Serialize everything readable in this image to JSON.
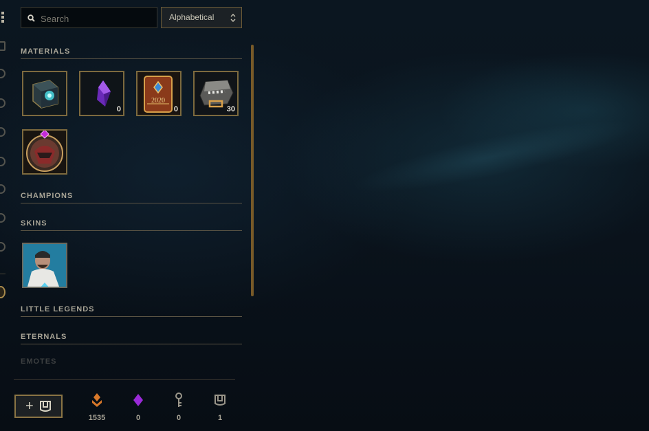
{
  "search": {
    "placeholder": "Search",
    "value": ""
  },
  "sort": {
    "selected": "Alphabetical"
  },
  "sections": {
    "materials": "MATERIALS",
    "champions": "CHAMPIONS",
    "skins": "SKINS",
    "little_legends": "LITTLE LEGENDS",
    "eternals": "ETERNALS",
    "emotes": "EMOTES"
  },
  "materials": [
    {
      "name": "hextech-chest-icon",
      "count": ""
    },
    {
      "name": "gemstone-icon",
      "count": "0"
    },
    {
      "name": "event-pass-token-icon",
      "count": "0",
      "label": "2020"
    },
    {
      "name": "key-fragment-chest-icon",
      "count": "30"
    },
    {
      "name": "champion-orb-icon",
      "count": ""
    }
  ],
  "skins": [
    {
      "name": "skin-shard-icon"
    }
  ],
  "footer": {
    "craft_label": "+",
    "currencies": [
      {
        "name": "orange-essence-icon",
        "value": "1535",
        "color": "#d8782a"
      },
      {
        "name": "mythic-essence-icon",
        "value": "0",
        "color": "#9a2ad8"
      },
      {
        "name": "key-fragment-icon",
        "value": "0",
        "color": "#9a968a"
      },
      {
        "name": "chest-icon",
        "value": "1",
        "color": "#9a968a"
      }
    ]
  },
  "colors": {
    "accent_gold": "#c8aa6e",
    "background": "#091018"
  }
}
